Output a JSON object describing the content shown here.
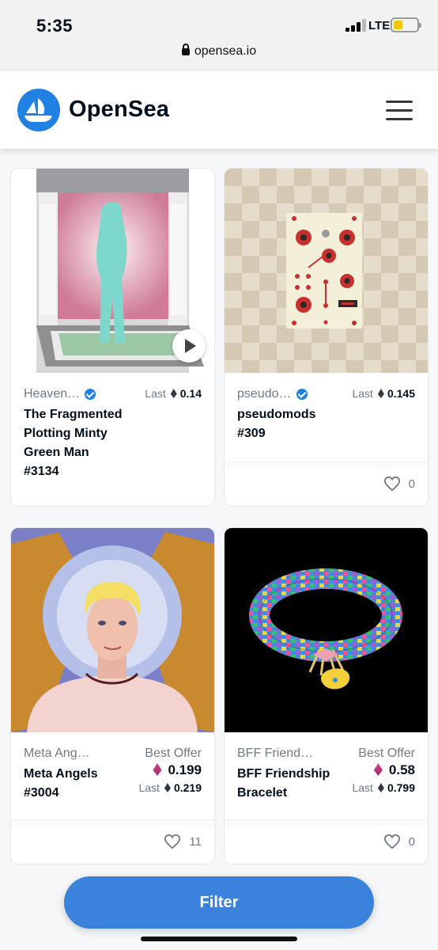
{
  "status_bar": {
    "time": "5:35",
    "network": "LTE"
  },
  "browser": {
    "url": "opensea.io"
  },
  "header": {
    "brand": "OpenSea"
  },
  "colors": {
    "brand_blue": "#2081e2",
    "filter_blue": "#3b82dc",
    "eth_pink": "#d6448f"
  },
  "cards": [
    {
      "collection": "Heaven…",
      "verified": true,
      "name": "The Fragmented Plotting Minty Green Man #3134",
      "last_label": "Last",
      "last_price": "0.14",
      "has_play_button": true
    },
    {
      "collection": "pseudo…",
      "verified": true,
      "name": "pseudomods #309",
      "last_label": "Last",
      "last_price": "0.145",
      "likes": "0"
    },
    {
      "collection": "Meta Ang…",
      "name": "Meta Angels #3004",
      "best_offer_label": "Best Offer",
      "best_offer": "0.199",
      "last_label": "Last",
      "last_price": "0.219",
      "likes": "11"
    },
    {
      "collection": "BFF Friend…",
      "name": "BFF Friendship Bracelet",
      "best_offer_label": "Best Offer",
      "best_offer": "0.58",
      "last_label": "Last",
      "last_price": "0.799",
      "likes": "0"
    }
  ],
  "filter_button": {
    "label": "Filter"
  }
}
